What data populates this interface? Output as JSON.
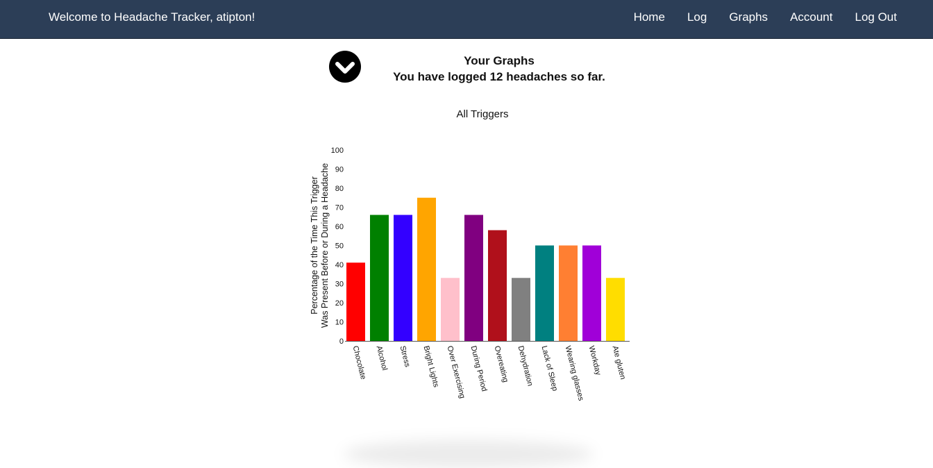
{
  "navbar": {
    "brand": "Welcome to Headache Tracker, atipton!",
    "links": [
      "Home",
      "Log",
      "Graphs",
      "Account",
      "Log Out"
    ]
  },
  "page": {
    "title": "Your Graphs",
    "subtitle": "You have logged 12 headaches so far.",
    "toggle_icon": "chevron-down-circle-icon"
  },
  "chart_data": {
    "type": "bar",
    "title": "All Triggers",
    "ylabel_lines": [
      "Percentage of the Time This Trigger",
      "Was Present Before or During a Headache"
    ],
    "xlabel": "",
    "ylim": [
      0,
      100
    ],
    "yticks": [
      0,
      10,
      20,
      30,
      40,
      50,
      60,
      70,
      80,
      90,
      100
    ],
    "categories": [
      "Chocolate",
      "Alcohol",
      "Stress",
      "Bright Lights",
      "Over Exercising",
      "During Period",
      "Overeating",
      "Dehydration",
      "Lack of Sleep",
      "Wearing glasses",
      "Workday",
      "Ate gluten"
    ],
    "values": [
      41,
      66,
      66,
      75,
      33,
      66,
      58,
      33,
      50,
      50,
      50,
      33
    ],
    "colors": [
      "#ff0000",
      "#008000",
      "#3300ff",
      "#ffa500",
      "#ffc0cb",
      "#800080",
      "#b0101b",
      "#808080",
      "#008080",
      "#ff7f32",
      "#a000d8",
      "#ffdd00"
    ],
    "grid": false
  }
}
